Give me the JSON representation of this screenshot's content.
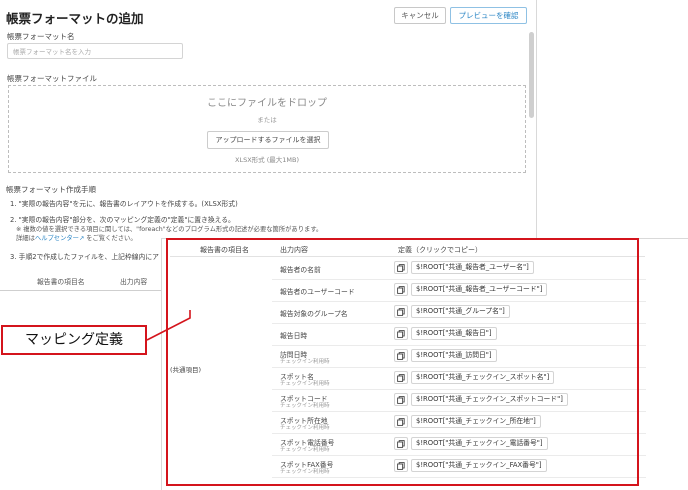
{
  "dialog": {
    "title": "帳票フォーマットの追加",
    "cancel_label": "キャンセル",
    "preview_label": "プレビューを確認",
    "name_label": "帳票フォーマット名",
    "name_placeholder": "帳票フォーマット名を入力",
    "file_label": "帳票フォーマットファイル",
    "dropzone": {
      "main_text": "ここにファイルをドロップ",
      "or_text": "または",
      "upload_button": "アップロードするファイルを選択",
      "note": "XLSX形式 (最大1MB)"
    },
    "procedure": {
      "title": "帳票フォーマット作成手順",
      "step1": "1. \"実際の報告内容\"を元に、報告書のレイアウトを作成する。(XLSX形式)",
      "step2": "2. \"実際の報告内容\"部分を、次のマッピング定義の\"定義\"に置き換える。",
      "step2_note": "※ 複数の値を選択できる項目に関しては、\"foreach\"などのプログラム形式の記述が必要な箇所があります。",
      "step2_link_prefix": "詳細は",
      "step2_link": "ヘルプセンター",
      "step2_link_suffix": " をご覧ください。",
      "step3": "3. 手順2で作成したファイルを、上記枠線内にア"
    },
    "bg_table_headers": [
      "報告書の項目名",
      "出力内容"
    ]
  },
  "mapping": {
    "headers": {
      "item_name": "報告書の項目名",
      "output": "出力内容",
      "definition": "定義（クリックでコピー）"
    },
    "group_label": "(共通項目)",
    "rows": [
      {
        "name": "報告者の名前",
        "sub": "",
        "definition": "$!ROOT[\"共通_報告者_ユーザー名\"]"
      },
      {
        "name": "報告者のユーザーコード",
        "sub": "",
        "definition": "$!ROOT[\"共通_報告者_ユーザーコード\"]"
      },
      {
        "name": "報告対象のグループ名",
        "sub": "",
        "definition": "$!ROOT[\"共通_グループ名\"]"
      },
      {
        "name": "報告日時",
        "sub": "",
        "definition": "$!ROOT[\"共通_報告日\"]"
      },
      {
        "name": "訪問日時",
        "sub": "チェックイン利用時",
        "definition": "$!ROOT[\"共通_訪問日\"]"
      },
      {
        "name": "スポット名",
        "sub": "チェックイン利用時",
        "definition": "$!ROOT[\"共通_チェックイン_スポット名\"]"
      },
      {
        "name": "スポットコード",
        "sub": "チェックイン利用時",
        "definition": "$!ROOT[\"共通_チェックイン_スポットコード\"]"
      },
      {
        "name": "スポット所在地",
        "sub": "チェックイン利用時",
        "definition": "$!ROOT[\"共通_チェックイン_所在地\"]"
      },
      {
        "name": "スポット電話番号",
        "sub": "チェックイン利用時",
        "definition": "$!ROOT[\"共通_チェックイン_電話番号\"]"
      },
      {
        "name": "スポットFAX番号",
        "sub": "チェックイン利用時",
        "definition": "$!ROOT[\"共通_チェックイン_FAX番号\"]"
      }
    ]
  },
  "callout": {
    "label": "マッピング定義"
  },
  "colors": {
    "highlight": "#d4141c",
    "accent": "#2b86c5"
  }
}
